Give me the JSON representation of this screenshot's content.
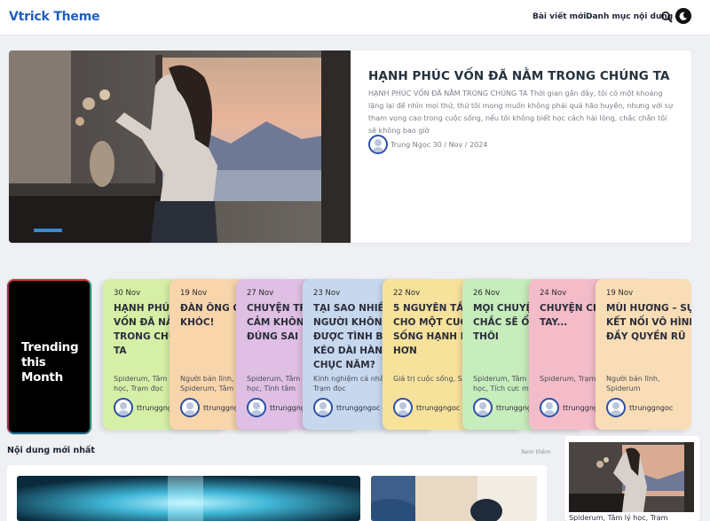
{
  "header": {
    "logo": "Vtrick Theme",
    "nav": [
      {
        "label": "Bài viết mới"
      },
      {
        "label": "Danh mục nội dung"
      }
    ]
  },
  "hero": {
    "title": "HẠNH PHÚC VỐN ĐÃ NẰM TRONG CHÚNG TA",
    "excerpt": "HẠNH PHÚC VỐN ĐÃ NẰM TRONG CHÚNG TA Thời gian gần đây, tôi có một khoảng lặng lại để nhìn mọi thứ, thứ tôi mong muốn không phải quá hão huyền, nhưng với sự tham vọng cao trong cuộc sống, nếu tôi không biết học cách hài lòng, chắc chắn tôi sẽ không bao giờ",
    "meta": "Trung Ngọc 30 / Nov / 2024"
  },
  "trending": {
    "label": "Trending this Month",
    "cards": [
      {
        "date": "30 Nov",
        "title": "HẠNH PHÚC\nVỐN ĐÃ NẰM\nTRONG CHÚNG\nTA",
        "cats": "Spiderum, Tâm lý\nhọc, Trạm đọc",
        "author": "ttrunggngoc",
        "color": "#d6efa6"
      },
      {
        "date": "19 Nov",
        "title": "ĐÀN ÔNG CŨNG\nKHÓC!",
        "cats": "Người bản lĩnh,\nSpiderum, Tâm lý",
        "author": "ttrunggngoc",
        "color": "#f8d5ab"
      },
      {
        "date": "27 Nov",
        "title": "CHUYỆN TRĂM\nCẢM KHÔNG CÓ\nĐÚNG SAI",
        "cats": "Spiderum, Tâm lý\nhọc, Tình tâm",
        "author": "ttrunggngoc",
        "color": "#dfbfe3"
      },
      {
        "date": "23 Nov",
        "title": "TẠI SAO NHIỀU\nNGƯỜI KHÔNG CÓ\nĐƯỢC TÌNH BẠN\nKÉO DÀI HÀNG\nCHỤC NĂM?",
        "cats": "Kinh nghiệm cá nhân,\nTrạm đọc",
        "author": "ttrunggngoc",
        "color": "#c7d8ee"
      },
      {
        "date": "22 Nov",
        "title": "5 NGUYÊN TẮC\nCHO MỘT CUỘC\nSỐNG HẠNH PHÚC\nHƠN",
        "cats": "Giá trị cuộc sống, Sách",
        "author": "ttrunggngoc",
        "color": "#f7e29c"
      },
      {
        "date": "26 Nov",
        "title": "MỌI CHUYỆN\nCHẮC SẼ ỔN\nTHÔI",
        "cats": "Spiderum, Tâm lý\nhọc, Tích cực mỗi",
        "author": "ttrunggngoc",
        "color": "#c6edbb"
      },
      {
        "date": "24 Nov",
        "title": "CHUYỆN CHIA\nTAY...",
        "cats": "Spiderum, Trạm đọc",
        "author": "ttrunggngoc",
        "color": "#f4bcc9"
      },
      {
        "date": "19 Nov",
        "title": "MÙI HƯƠNG – SỰ\nKẾT NỐI VÔ HÌNH\nĐẦY QUYỀN RŨ",
        "cats": "Người bản lĩnh,\nSpiderum",
        "author": "ttrunggngoc",
        "color": "#f9ddb6"
      }
    ]
  },
  "latest": {
    "title": "Nội dung mới nhất",
    "see_more": "Xem thêm"
  },
  "side": {
    "cats": "Spiderum, Tâm lý học, Trạm"
  }
}
